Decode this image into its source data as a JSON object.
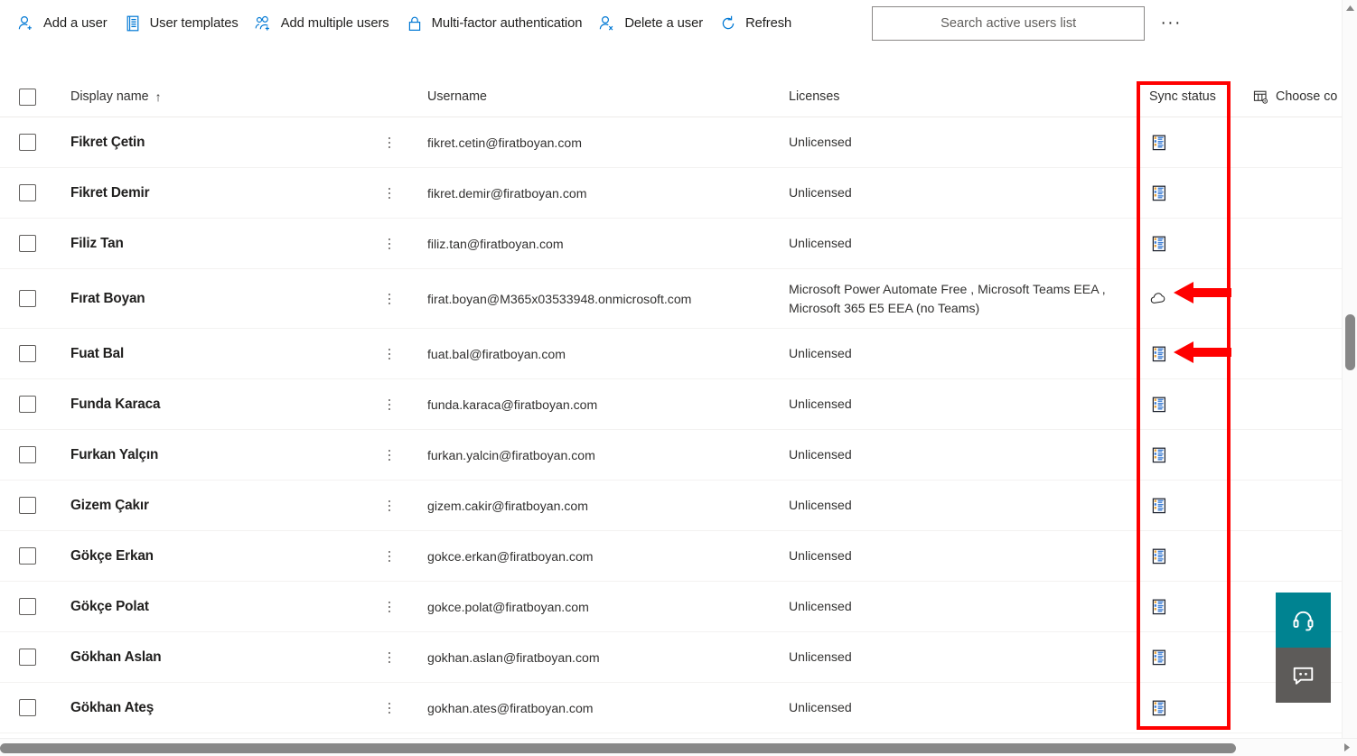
{
  "toolbar": {
    "actions": [
      {
        "label": "Add a user",
        "icon": "add-user-icon"
      },
      {
        "label": "User templates",
        "icon": "user-templates-icon"
      },
      {
        "label": "Add multiple users",
        "icon": "add-multiple-users-icon"
      },
      {
        "label": "Multi-factor authentication",
        "icon": "lock-icon"
      },
      {
        "label": "Delete a user",
        "icon": "delete-user-icon"
      },
      {
        "label": "Refresh",
        "icon": "refresh-icon"
      }
    ],
    "search": {
      "placeholder": "Search active users list",
      "value": ""
    },
    "overflow_label": "···"
  },
  "table": {
    "columns": {
      "display_name": "Display name",
      "sort_indicator": "↑",
      "username": "Username",
      "licenses": "Licenses",
      "sync_status": "Sync status",
      "choose_columns": "Choose co"
    },
    "rows": [
      {
        "display_name": "Fikret Çetin",
        "username": "fikret.cetin@firatboyan.com",
        "licenses": "Unlicensed",
        "sync_status_icon": "synced-from-on-premises-icon",
        "annotated": false
      },
      {
        "display_name": "Fikret Demir",
        "username": "fikret.demir@firatboyan.com",
        "licenses": "Unlicensed",
        "sync_status_icon": "synced-from-on-premises-icon",
        "annotated": false
      },
      {
        "display_name": "Filiz Tan",
        "username": "filiz.tan@firatboyan.com",
        "licenses": "Unlicensed",
        "sync_status_icon": "synced-from-on-premises-icon",
        "annotated": false
      },
      {
        "display_name": "Fırat Boyan",
        "username": "firat.boyan@M365x03533948.onmicrosoft.com",
        "licenses": "Microsoft Power Automate Free , Microsoft Teams EEA , Microsoft 365 E5 EEA (no Teams)",
        "sync_status_icon": "cloud-icon",
        "annotated": true
      },
      {
        "display_name": "Fuat Bal",
        "username": "fuat.bal@firatboyan.com",
        "licenses": "Unlicensed",
        "sync_status_icon": "synced-from-on-premises-icon",
        "annotated": true
      },
      {
        "display_name": "Funda Karaca",
        "username": "funda.karaca@firatboyan.com",
        "licenses": "Unlicensed",
        "sync_status_icon": "synced-from-on-premises-icon",
        "annotated": false
      },
      {
        "display_name": "Furkan Yalçın",
        "username": "furkan.yalcin@firatboyan.com",
        "licenses": "Unlicensed",
        "sync_status_icon": "synced-from-on-premises-icon",
        "annotated": false
      },
      {
        "display_name": "Gizem Çakır",
        "username": "gizem.cakir@firatboyan.com",
        "licenses": "Unlicensed",
        "sync_status_icon": "synced-from-on-premises-icon",
        "annotated": false
      },
      {
        "display_name": "Gökçe Erkan",
        "username": "gokce.erkan@firatboyan.com",
        "licenses": "Unlicensed",
        "sync_status_icon": "synced-from-on-premises-icon",
        "annotated": false
      },
      {
        "display_name": "Gökçe Polat",
        "username": "gokce.polat@firatboyan.com",
        "licenses": "Unlicensed",
        "sync_status_icon": "synced-from-on-premises-icon",
        "annotated": false
      },
      {
        "display_name": "Gökhan Aslan",
        "username": "gokhan.aslan@firatboyan.com",
        "licenses": "Unlicensed",
        "sync_status_icon": "synced-from-on-premises-icon",
        "annotated": false
      },
      {
        "display_name": "Gökhan Ateş",
        "username": "gokhan.ates@firatboyan.com",
        "licenses": "Unlicensed",
        "sync_status_icon": "synced-from-on-premises-icon",
        "annotated": false
      }
    ]
  },
  "floating": {
    "help_icon": "headset-icon",
    "feedback_icon": "feedback-chat-icon"
  },
  "annotation": {
    "color": "#ff0000",
    "box_target": "sync-status-column",
    "arrows": 2
  },
  "colors": {
    "accent": "#0078d4",
    "text": "#201f1e",
    "muted": "#605e5c",
    "divider": "#edebe9",
    "help_teal": "#008391",
    "feedback_gray": "#5d5b59",
    "annotation_red": "#ff0000"
  }
}
